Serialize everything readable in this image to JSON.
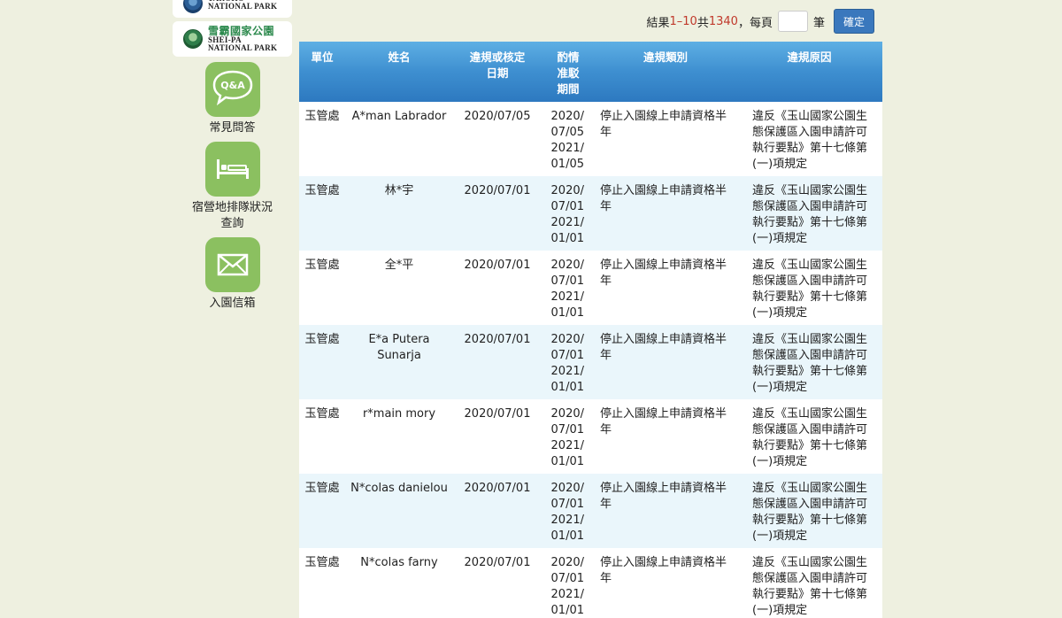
{
  "sidebar": {
    "parks": [
      {
        "zh": "",
        "en": "TAROKO\nNATIONAL PARK"
      },
      {
        "zh": "雪霸國家公園",
        "en": "SHEI-PA\nNATIONAL PARK"
      }
    ],
    "nav": [
      {
        "label": "常見問答",
        "icon": "qa-bubble-icon",
        "badge": "Q&A"
      },
      {
        "label": "宿營地排隊狀況查詢",
        "icon": "bed-icon"
      },
      {
        "label": "入園信箱",
        "icon": "mail-icon"
      }
    ]
  },
  "pager": {
    "prefix": "結果 ",
    "range": "1–10",
    "mid": " 共 ",
    "total": "1340",
    "suffix": "，每頁",
    "per_page_value": "",
    "unit": "筆",
    "confirm_label": "確定"
  },
  "colors": {
    "header": "#3e8fd0",
    "accent_red": "#c0392b",
    "tile_green": "#8bc060",
    "row_alt": "#eaf6fb"
  },
  "table": {
    "headers": [
      "單位",
      "姓名",
      "違規或核定日期",
      "酌情准駁期間",
      "違規類別",
      "違規原因"
    ],
    "rows": [
      {
        "unit": "玉管處",
        "name": "A*man Labrador",
        "date": "2020/07/05",
        "period": "2020/\n07/05\n2021/\n01/05",
        "category": "停止入園線上申請資格半年",
        "reason": "違反《玉山國家公園生態保護區入園申請許可執行要點》第十七條第(一)項規定"
      },
      {
        "unit": "玉管處",
        "name": "林*宇",
        "date": "2020/07/01",
        "period": "2020/\n07/01\n2021/\n01/01",
        "category": "停止入園線上申請資格半年",
        "reason": "違反《玉山國家公園生態保護區入園申請許可執行要點》第十七條第(一)項規定"
      },
      {
        "unit": "玉管處",
        "name": "全*平",
        "date": "2020/07/01",
        "period": "2020/\n07/01\n2021/\n01/01",
        "category": "停止入園線上申請資格半年",
        "reason": "違反《玉山國家公園生態保護區入園申請許可執行要點》第十七條第(一)項規定"
      },
      {
        "unit": "玉管處",
        "name": "E*a Putera Sunarja",
        "date": "2020/07/01",
        "period": "2020/\n07/01\n2021/\n01/01",
        "category": "停止入園線上申請資格半年",
        "reason": "違反《玉山國家公園生態保護區入園申請許可執行要點》第十七條第(一)項規定"
      },
      {
        "unit": "玉管處",
        "name": "r*main mory",
        "date": "2020/07/01",
        "period": "2020/\n07/01\n2021/\n01/01",
        "category": "停止入園線上申請資格半年",
        "reason": "違反《玉山國家公園生態保護區入園申請許可執行要點》第十七條第(一)項規定"
      },
      {
        "unit": "玉管處",
        "name": "N*colas danielou",
        "date": "2020/07/01",
        "period": "2020/\n07/01\n2021/\n01/01",
        "category": "停止入園線上申請資格半年",
        "reason": "違反《玉山國家公園生態保護區入園申請許可執行要點》第十七條第(一)項規定"
      },
      {
        "unit": "玉管處",
        "name": "N*colas farny",
        "date": "2020/07/01",
        "period": "2020/\n07/01\n2021/\n01/01",
        "category": "停止入園線上申請資格半年",
        "reason": "違反《玉山國家公園生態保護區入園申請許可執行要點》第十七條第(一)項規定"
      }
    ]
  }
}
